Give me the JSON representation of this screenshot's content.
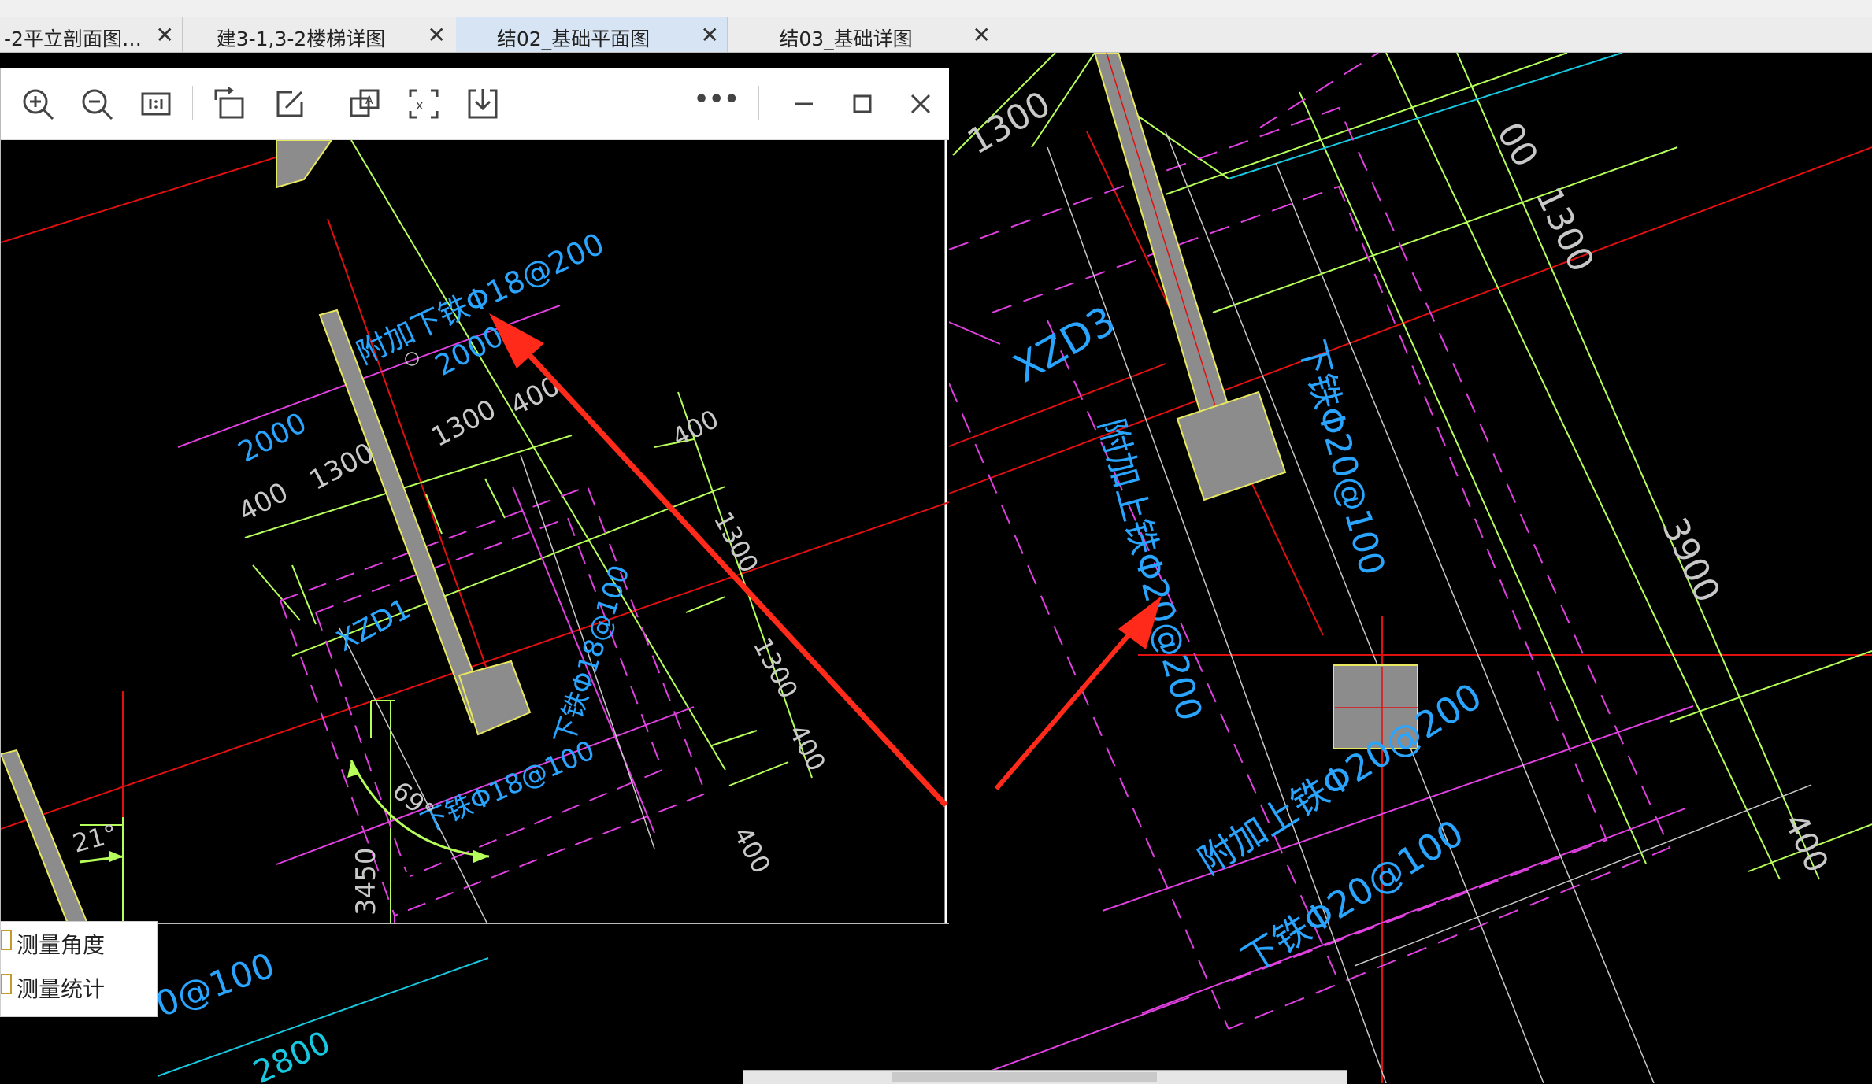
{
  "tabs": [
    {
      "label": "-2平立剖面图…",
      "close": "✕",
      "active": false
    },
    {
      "label": "建3-1,3-2楼梯详图",
      "close": "✕",
      "active": false
    },
    {
      "label": "结02_基础平面图",
      "close": "✕",
      "active": true
    },
    {
      "label": "结03_基础详图",
      "close": "✕",
      "active": false
    }
  ],
  "viewer": {
    "toolbar_icons": [
      "zoom-in-icon",
      "zoom-out-icon",
      "actual-size-icon",
      "rotate-icon",
      "edit-icon",
      "copy-text-icon",
      "crop-icon",
      "download-icon",
      "more-icon",
      "minimize-icon",
      "maximize-icon",
      "close-icon"
    ],
    "more_label": "•••",
    "drawing": {
      "rebar_extra": "附加下铁Φ18@200",
      "dim_2000_a": "2000",
      "dim_2000_b": "2000",
      "dim_400_a": "400",
      "dim_1300_a": "1300",
      "dim_1300_b": "1300",
      "dim_400_b": "400",
      "dim_400_c": "400",
      "dim_400_d": "400",
      "dim_1300_c": "1300",
      "dim_1300_d": "1300",
      "dim_400_e": "400",
      "footing_label": "XZD1",
      "rebar_right": "下铁Φ18@100",
      "rebar_bottom": "下铁Φ18@100",
      "angle_69": "69°",
      "angle_21": "21°",
      "dim_3450": "3450"
    }
  },
  "main_drawing": {
    "dim_1300_top": "1300",
    "dim_00_top": "00",
    "dim_1300_right": "1300",
    "footing_label": "XZD3",
    "rebar_extra_upper": "附加上铁Φ20@200",
    "rebar_lower_right": "下铁Φ20@100",
    "dim_3900": "3900",
    "rebar_extra_upper_2": "附加上铁Φ20@200",
    "rebar_lower": "下铁Φ20@100",
    "dim_400_right": "400",
    "partial_rebar": "0@100",
    "dim_2800": "2800"
  },
  "context_menu": {
    "items": [
      "测量角度",
      "测量统计"
    ]
  },
  "colors": {
    "cad_bg": "#000000",
    "dimension_green": "#b6ff5a",
    "text_cyan": "#2aa5ff",
    "axis_red": "#e01010",
    "outline_magenta": "#e040e0",
    "column_grey": "#8c8c8c",
    "arrow_red": "#ff2a1a"
  }
}
